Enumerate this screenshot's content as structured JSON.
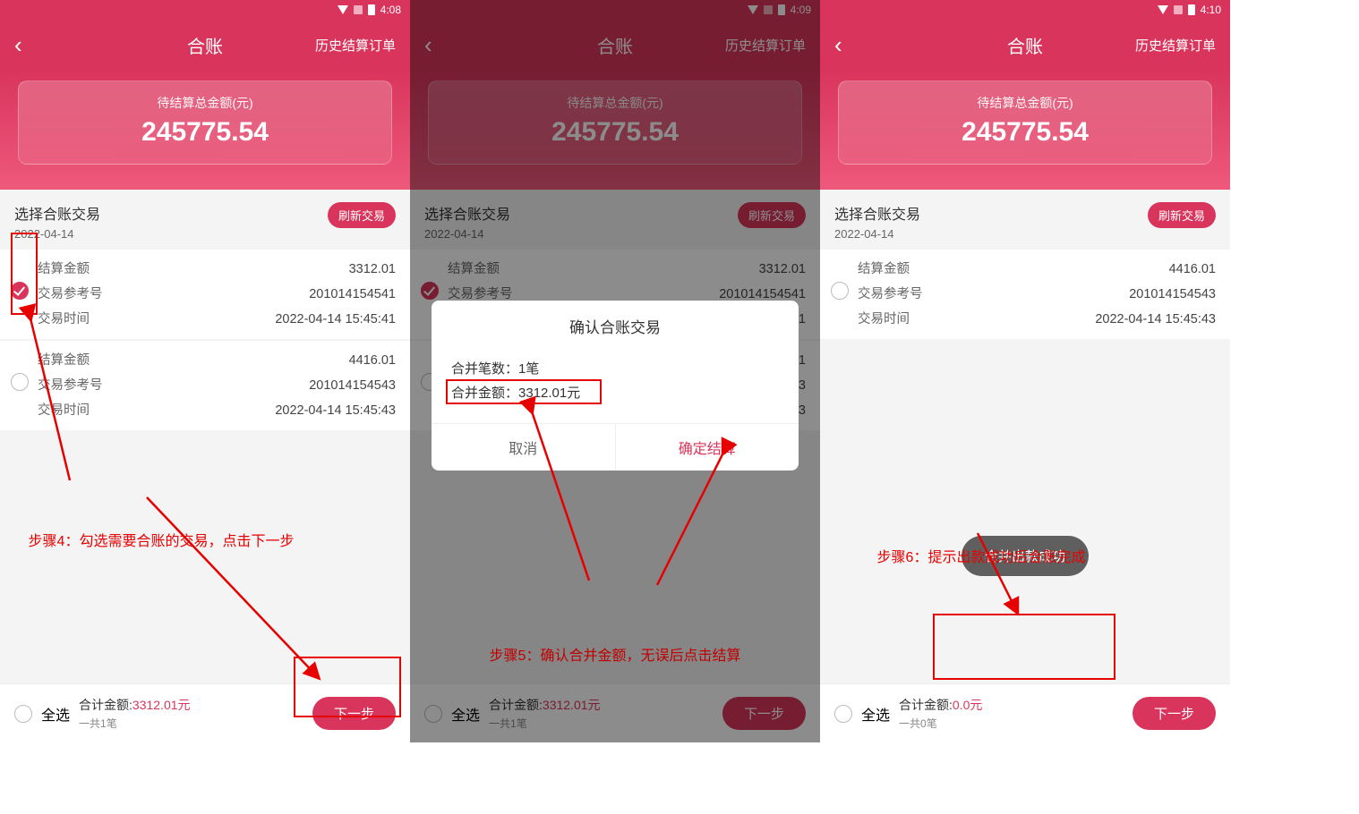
{
  "screens": [
    {
      "time": "4:08"
    },
    {
      "time": "4:09"
    },
    {
      "time": "4:10"
    }
  ],
  "header": {
    "title": "合账",
    "rightlink": "历史结算订单"
  },
  "amountcard": {
    "label": "待结算总金额(元)",
    "value": "245775.54"
  },
  "section": {
    "title": "选择合账交易",
    "date": "2022-04-14",
    "refresh": "刷新交易"
  },
  "labels": {
    "amount": "结算金额",
    "ref": "交易参考号",
    "time": "交易时间"
  },
  "txns_a": [
    {
      "amount": "3312.01",
      "ref": "201014154541",
      "time": "2022-04-14 15:45:41",
      "checked": true
    },
    {
      "amount": "4416.01",
      "ref": "201014154543",
      "time": "2022-04-14 15:45:43",
      "checked": false
    }
  ],
  "txns_c": [
    {
      "amount": "4416.01",
      "ref": "201014154543",
      "time": "2022-04-14 15:45:43",
      "checked": false
    }
  ],
  "footer": {
    "selectall": "全选",
    "totallabel": "合计金额:",
    "next": "下一步",
    "a": {
      "amount": "3312.01元",
      "count": "一共1笔"
    },
    "c": {
      "amount": "0.0元",
      "count": "一共0笔"
    }
  },
  "dialog": {
    "title": "确认合账交易",
    "line1_label": "合并笔数：",
    "line1_value": "1笔",
    "line2_label": "合并金额：",
    "line2_value": "3312.01元",
    "cancel": "取消",
    "confirm": "确定结算"
  },
  "toast": "合并出款成功",
  "annotations": {
    "step4": "步骤4：勾选需要合账的交易，点击下一步",
    "step5": "步骤5：确认合并金额，无误后点击结算",
    "step6": "步骤6：提示出款成功后合账完成"
  }
}
